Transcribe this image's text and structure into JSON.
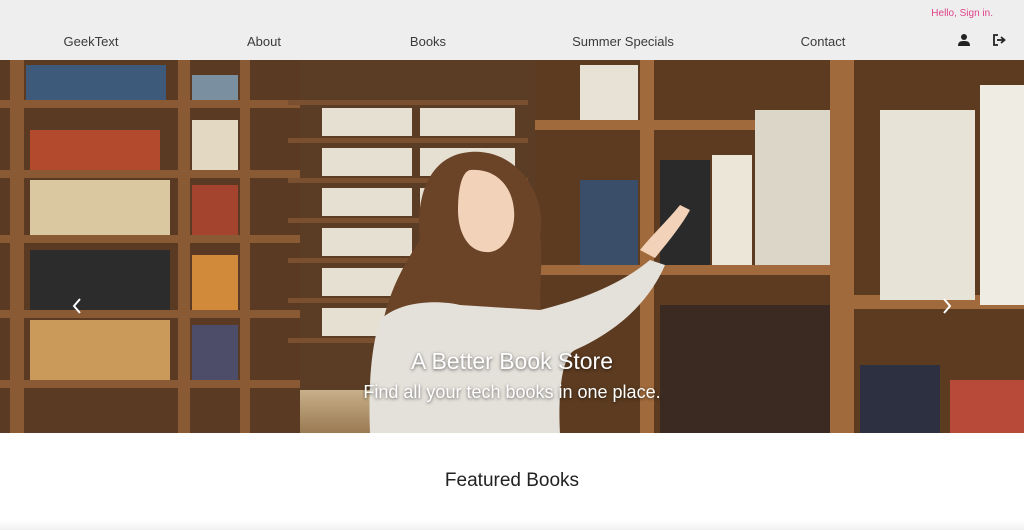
{
  "header": {
    "signin": "Hello, Sign in.",
    "nav": [
      {
        "label": "GeekText"
      },
      {
        "label": "About"
      },
      {
        "label": "Books"
      },
      {
        "label": "Summer Specials"
      },
      {
        "label": "Contact"
      }
    ],
    "icons": [
      "user-icon",
      "sign-out-icon"
    ]
  },
  "carousel": {
    "title": "A Better Book Store",
    "subtitle": "Find all your tech books in one place.",
    "slides": 2,
    "active_slide": 1,
    "prev_icon": "chevron-left-icon",
    "next_icon": "chevron-right-icon"
  },
  "featured": {
    "heading": "Featured Books"
  },
  "colors": {
    "accent": "#e0438a",
    "topbar": "#eeeeee"
  }
}
